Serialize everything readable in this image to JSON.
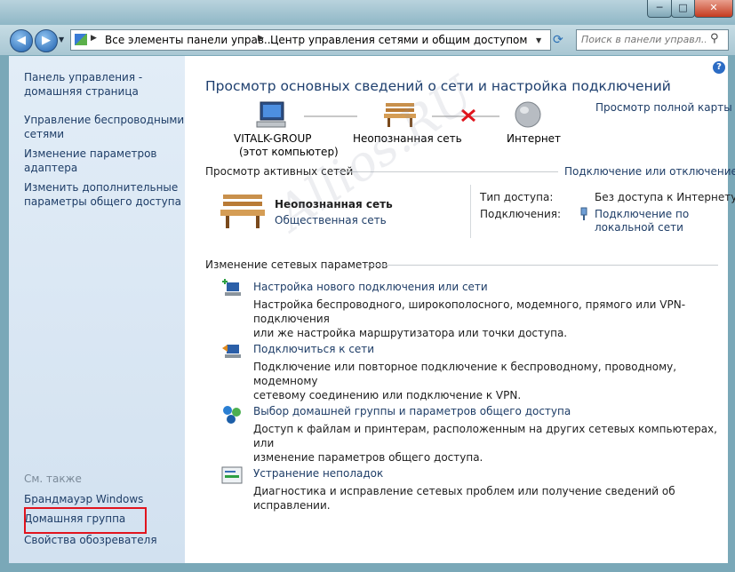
{
  "window": {
    "minimize_label": "─",
    "maximize_label": "□",
    "close_label": "✕"
  },
  "nav": {
    "back_glyph": "◀",
    "forward_glyph": "▶",
    "history_glyph": "▼"
  },
  "address": {
    "crumbs": [
      "Все элементы панели управ...",
      "Центр управления сетями и общим доступом"
    ],
    "separator": "▶",
    "dropdown_glyph": "▼",
    "refresh_glyph": "⟳"
  },
  "search": {
    "placeholder": "Поиск в панели управл...",
    "icon_glyph": "⚲"
  },
  "sidebar": {
    "items": [
      "Панель управления -\nдомашняя страница",
      "Управление беспроводными\nсетями",
      "Изменение параметров\nадаптера",
      "Изменить дополнительные\nпараметры общего доступа"
    ],
    "see_also_title": "См. также",
    "see_also": [
      "Брандмауэр Windows",
      "Домашняя группа",
      "Свойства обозревателя"
    ]
  },
  "main": {
    "help_glyph": "?",
    "title": "Просмотр основных сведений о сети и настройка подключений",
    "full_map_link": "Просмотр полной карты",
    "map": {
      "computer_name": "VITALK-GROUP",
      "computer_sub": "(этот компьютер)",
      "network_label": "Неопознанная сеть",
      "internet_label": "Интернет"
    },
    "active": {
      "title": "Просмотр активных сетей",
      "connect_link": "Подключение или отключение",
      "network_name": "Неопознанная сеть",
      "network_type": "Общественная сеть",
      "access_label": "Тип доступа:",
      "access_value": "Без доступа к Интернету",
      "connections_label": "Подключения:",
      "connection_line1": "Подключение по",
      "connection_line2": "локальной сети"
    },
    "change_title": "Изменение сетевых параметров",
    "tasks": [
      {
        "title": "Настройка нового подключения или сети",
        "desc": "Настройка беспроводного, широкополосного, модемного, прямого или VPN-подключения\nили же настройка маршрутизатора или точки доступа."
      },
      {
        "title": "Подключиться к сети",
        "desc": "Подключение или повторное подключение к беспроводному, проводному, модемному\nсетевому соединению или подключение к VPN."
      },
      {
        "title": "Выбор домашней группы и параметров общего доступа",
        "desc": "Доступ к файлам и принтерам, расположенным на других сетевых компьютерах, или\nизменение параметров общего доступа."
      },
      {
        "title": "Устранение неполадок",
        "desc": "Диагностика и исправление сетевых проблем или получение сведений об исправлении."
      }
    ]
  },
  "watermark": "Allios.RU"
}
